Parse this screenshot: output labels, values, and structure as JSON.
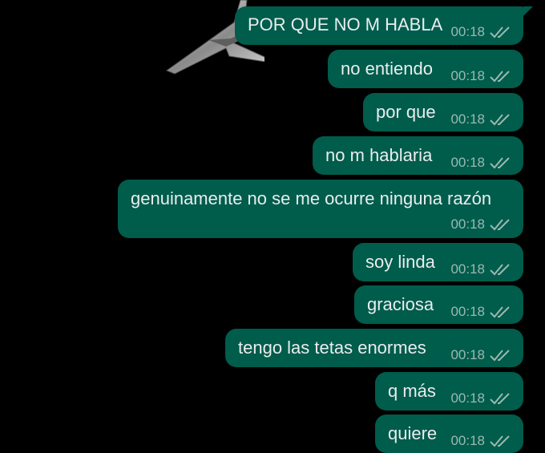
{
  "conversation": {
    "messages": [
      {
        "text": "POR QUE NO M HABLA",
        "time": "00:18",
        "status": "sent"
      },
      {
        "text": "no entiendo",
        "time": "00:18",
        "status": "sent"
      },
      {
        "text": "por que",
        "time": "00:18",
        "status": "sent"
      },
      {
        "text": "no m hablaria",
        "time": "00:18",
        "status": "sent"
      },
      {
        "text": "genuinamente no se me ocurre ninguna razón",
        "time": "00:18",
        "status": "sent"
      },
      {
        "text": "soy linda",
        "time": "00:18",
        "status": "sent"
      },
      {
        "text": "graciosa",
        "time": "00:18",
        "status": "sent"
      },
      {
        "text": "tengo las tetas enormes",
        "time": "00:18",
        "status": "sent"
      },
      {
        "text": "q más",
        "time": "00:18",
        "status": "sent"
      },
      {
        "text": "quiere",
        "time": "00:18",
        "status": "sent"
      }
    ]
  },
  "theme": {
    "background": "#000000",
    "bubble_color": "#005c4b",
    "text_color": "#e9edef",
    "meta_color": "#9bb9b1"
  },
  "icons": {
    "status": "double-check-icon",
    "wallpaper": "silver-star-icon"
  }
}
